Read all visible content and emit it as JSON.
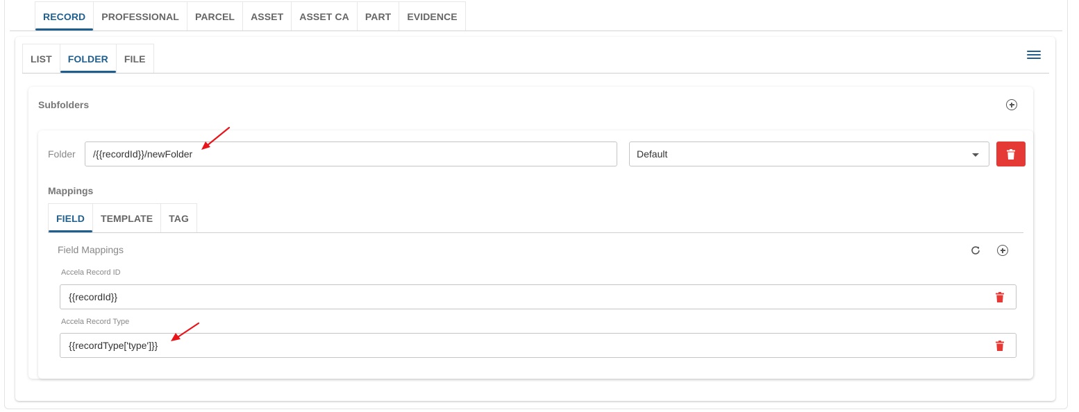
{
  "top_tabs": [
    "RECORD",
    "PROFESSIONAL",
    "PARCEL",
    "ASSET",
    "ASSET CA",
    "PART",
    "EVIDENCE"
  ],
  "inner_tabs": [
    "LIST",
    "FOLDER",
    "FILE"
  ],
  "subfolders": {
    "title": "Subfolders",
    "folder_label": "Folder",
    "folder_value": "/{{recordId}}/newFolder",
    "select_value": "Default"
  },
  "mappings": {
    "title": "Mappings",
    "tabs": [
      "FIELD",
      "TEMPLATE",
      "TAG"
    ],
    "field_mappings_title": "Field Mappings",
    "rows": [
      {
        "label": "Accela Record ID",
        "value": "{{recordId}}"
      },
      {
        "label": "Accela Record Type",
        "value": "{{recordType['type']}}"
      }
    ]
  },
  "colors": {
    "accent": "#1f5f8f",
    "danger": "#e53935",
    "annotation_arrow": "#e8141a"
  },
  "icons": [
    "hamburger-menu-icon",
    "add-circle-icon",
    "trash-icon",
    "refresh-icon",
    "chevron-down-icon",
    "arrow-annotation-icon"
  ]
}
